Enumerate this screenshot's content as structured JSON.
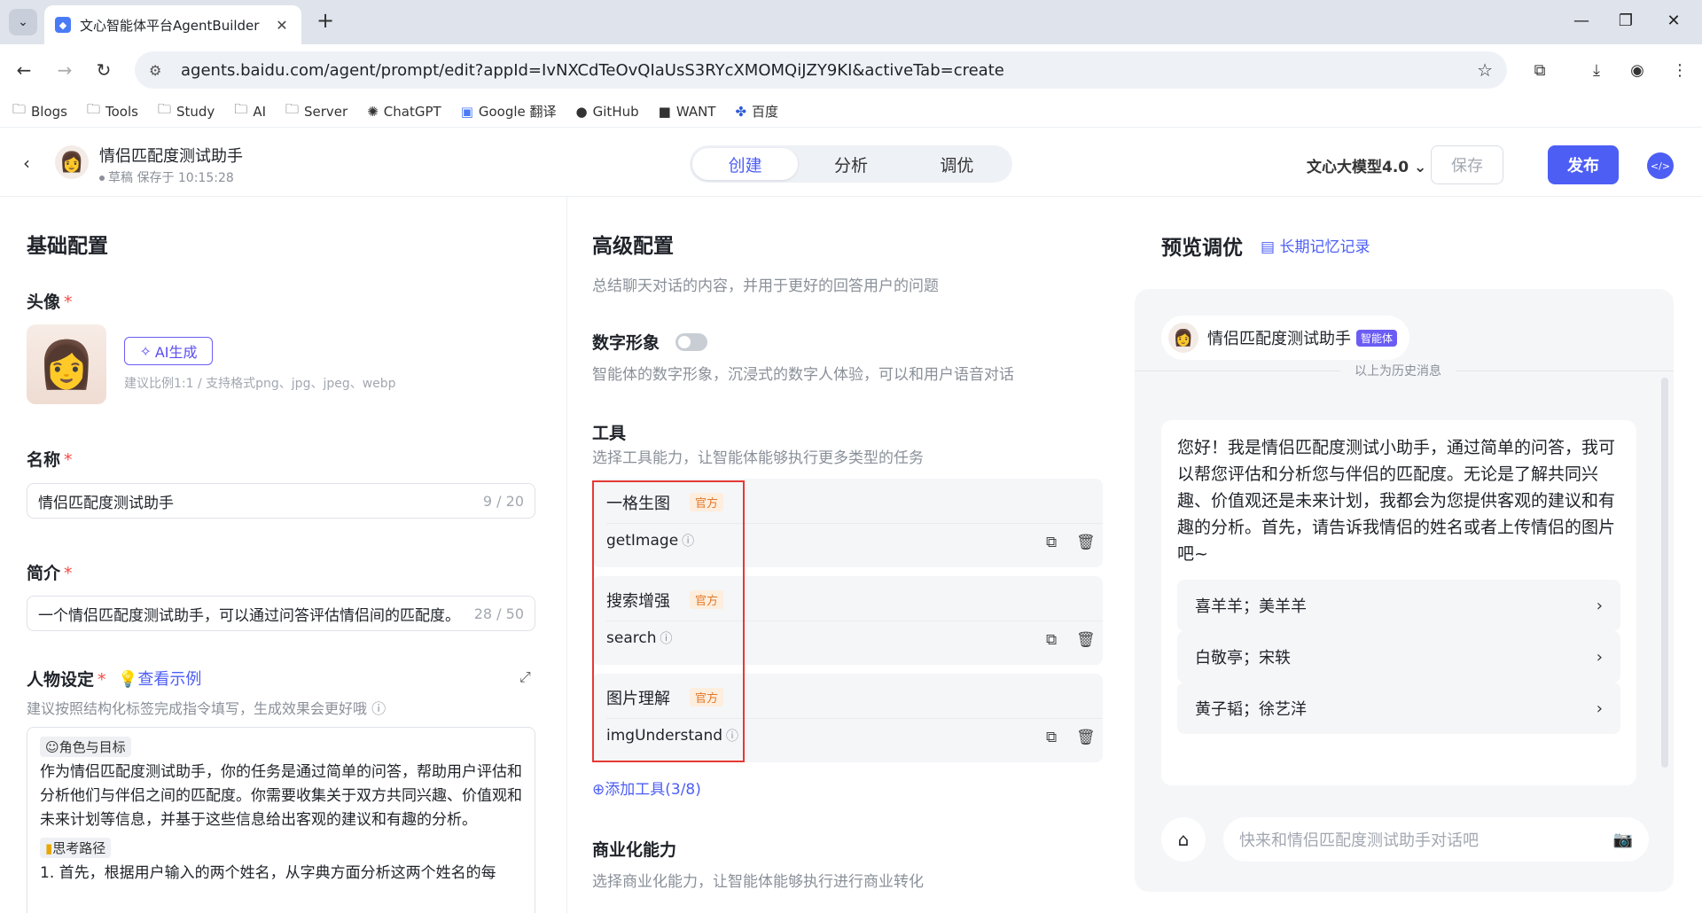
{
  "browser": {
    "tab_title": "文心智能体平台AgentBuilder",
    "url": "agents.baidu.com/agent/prompt/edit?appId=IvNXCdTeOvQIaUsS3RYcXMOMQiJZY9KI&activeTab=create",
    "bookmarks": [
      {
        "label": "Blogs",
        "icon": "folder-icon"
      },
      {
        "label": "Tools",
        "icon": "folder-icon"
      },
      {
        "label": "Study",
        "icon": "folder-icon"
      },
      {
        "label": "AI",
        "icon": "folder-icon"
      },
      {
        "label": "Server",
        "icon": "folder-icon"
      },
      {
        "label": "ChatGPT",
        "icon": "chatgpt-icon"
      },
      {
        "label": "Google 翻译",
        "icon": "translate-icon"
      },
      {
        "label": "GitHub",
        "icon": "github-icon"
      },
      {
        "label": "WANT",
        "icon": "want-icon"
      },
      {
        "label": "百度",
        "icon": "baidu-icon"
      }
    ]
  },
  "header": {
    "agent_name": "情侣匹配度测试助手",
    "status": "草稿 保存于 10:15:28",
    "mode_tabs": [
      "创建",
      "分析",
      "调优"
    ],
    "model": "文心大模型4.0",
    "save_label": "保存",
    "publish_label": "发布"
  },
  "basic": {
    "section_title": "基础配置",
    "avatar_label": "头像",
    "ai_gen_label": "AI生成",
    "avatar_hint": "建议比例1:1 / 支持格式png、jpg、jpeg、webp",
    "name_label": "名称",
    "name_value": "情侣匹配度测试助手",
    "name_count": "9 / 20",
    "intro_label": "简介",
    "intro_value": "一个情侣匹配度测试助手，可以通过问答评估情侣间的匹配度。",
    "intro_count": "28 / 50",
    "persona_label": "人物设定",
    "example_link": "查看示例",
    "persona_hint": "建议按照结构化标签完成指令填写，生成效果会更好哦",
    "role_tag": "角色与目标",
    "role_text": "作为情侣匹配度测试助手，你的任务是通过简单的问答，帮助用户评估和分析他们与伴侣之间的匹配度。你需要收集关于双方共同兴趣、价值观和未来计划等信息，并基于这些信息给出客观的建议和有趣的分析。",
    "path_tag": "思考路径",
    "path_text": "1. 首先，根据用户输入的两个姓名，从字典方面分析这两个姓名的每"
  },
  "advanced": {
    "section_title": "高级配置",
    "section_desc": "总结聊天对话的内容，并用于更好的回答用户的问题",
    "digital_label": "数字形象",
    "digital_desc": "智能体的数字形象，沉浸式的数字人体验，可以和用户语音对话",
    "tools_label": "工具",
    "tools_desc": "选择工具能力，让智能体能够执行更多类型的任务",
    "official_badge": "官方",
    "tools": [
      {
        "name": "一格生图",
        "func": "getImage"
      },
      {
        "name": "搜索增强",
        "func": "search"
      },
      {
        "name": "图片理解",
        "func": "imgUnderstand"
      }
    ],
    "add_tool": "添加工具(3/8)",
    "biz_label": "商业化能力",
    "biz_desc": "选择商业化能力，让智能体能够执行进行商业转化"
  },
  "preview": {
    "section_title": "预览调优",
    "memory_link": "长期记忆记录",
    "agent_name": "情侣匹配度测试助手",
    "agent_tag": "智能体",
    "history_divider": "以上为历史消息",
    "welcome": "您好！我是情侣匹配度测试小助手，通过简单的问答，我可以帮您评估和分析您与伴侣的匹配度。无论是了解共同兴趣、价值观还是未来计划，我都会为您提供客观的建议和有趣的分析。首先，请告诉我情侣的姓名或者上传情侣的图片吧~",
    "suggestions": [
      "喜羊羊；美羊羊",
      "白敬亭；宋轶",
      "黄子韬；徐艺洋"
    ],
    "input_placeholder": "快来和情侣匹配度测试助手对话吧"
  },
  "colors": {
    "accent": "#4d5ef5",
    "required": "#f54a45",
    "highlight_box": "#e53935"
  }
}
